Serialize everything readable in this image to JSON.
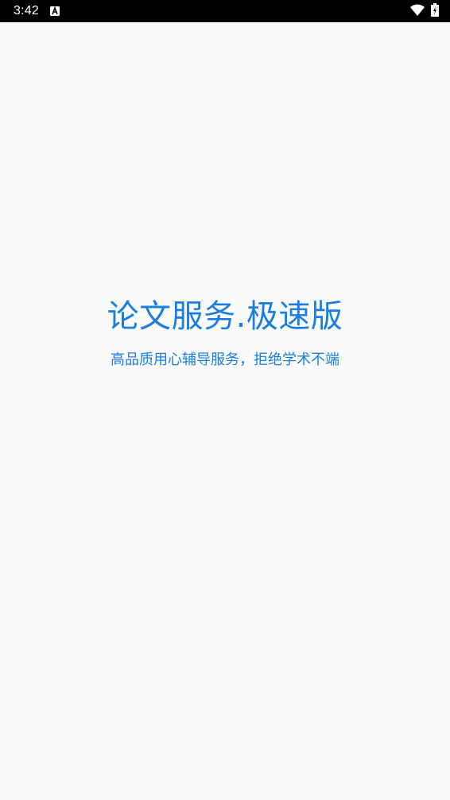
{
  "status_bar": {
    "time": "3:42",
    "notification_icon": "a-letter-icon",
    "wifi_icon": "wifi-icon",
    "battery_icon": "battery-charging-icon",
    "background": "#000000",
    "foreground": "#ffffff"
  },
  "splash": {
    "title": "论文服务.极速版",
    "subtitle": "高品质用心辅导服务，拒绝学术不端",
    "accent_color": "#1a7ee0",
    "background": "#fafafa"
  }
}
